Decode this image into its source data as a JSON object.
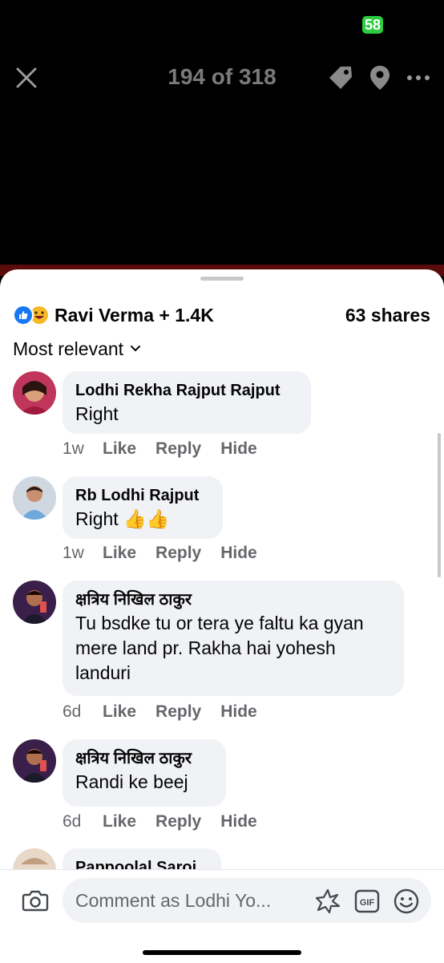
{
  "status": {
    "battery": "58"
  },
  "viewer": {
    "counter": "194 of 318"
  },
  "reactions": {
    "summary": "Ravi Verma + 1.4K",
    "shares": "63 shares"
  },
  "sort": {
    "label": "Most relevant"
  },
  "comments": [
    {
      "name": "Lodhi Rekha Rajput Rajput",
      "text": [
        "Right"
      ],
      "time": "1w",
      "like": "Like",
      "reply": "Reply",
      "hide": "Hide"
    },
    {
      "name": "Rb Lodhi Rajput",
      "text": [
        "Right 👍👍"
      ],
      "time": "1w",
      "like": "Like",
      "reply": "Reply",
      "hide": "Hide"
    },
    {
      "name": "क्षत्रिय निखिल ठाकुर",
      "text": [
        "Tu bsdke tu or tera ye faltu ka gyan",
        "mere land pr. Rakha hai yohesh",
        "landuri"
      ],
      "time": "6d",
      "like": "Like",
      "reply": "Reply",
      "hide": "Hide"
    },
    {
      "name": "क्षत्रिय निखिल ठाकुर",
      "text": [
        "Randi ke beej"
      ],
      "time": "6d",
      "like": "Like",
      "reply": "Reply",
      "hide": "Hide"
    },
    {
      "name": "Pappoolal Saroj"
    }
  ],
  "composer": {
    "placeholder": "Comment as Lodhi Yo..."
  },
  "colors": {
    "accent": "#1877f2",
    "bubble": "#f0f2f5",
    "meta": "#65676b",
    "battery": "#2ecc40"
  }
}
